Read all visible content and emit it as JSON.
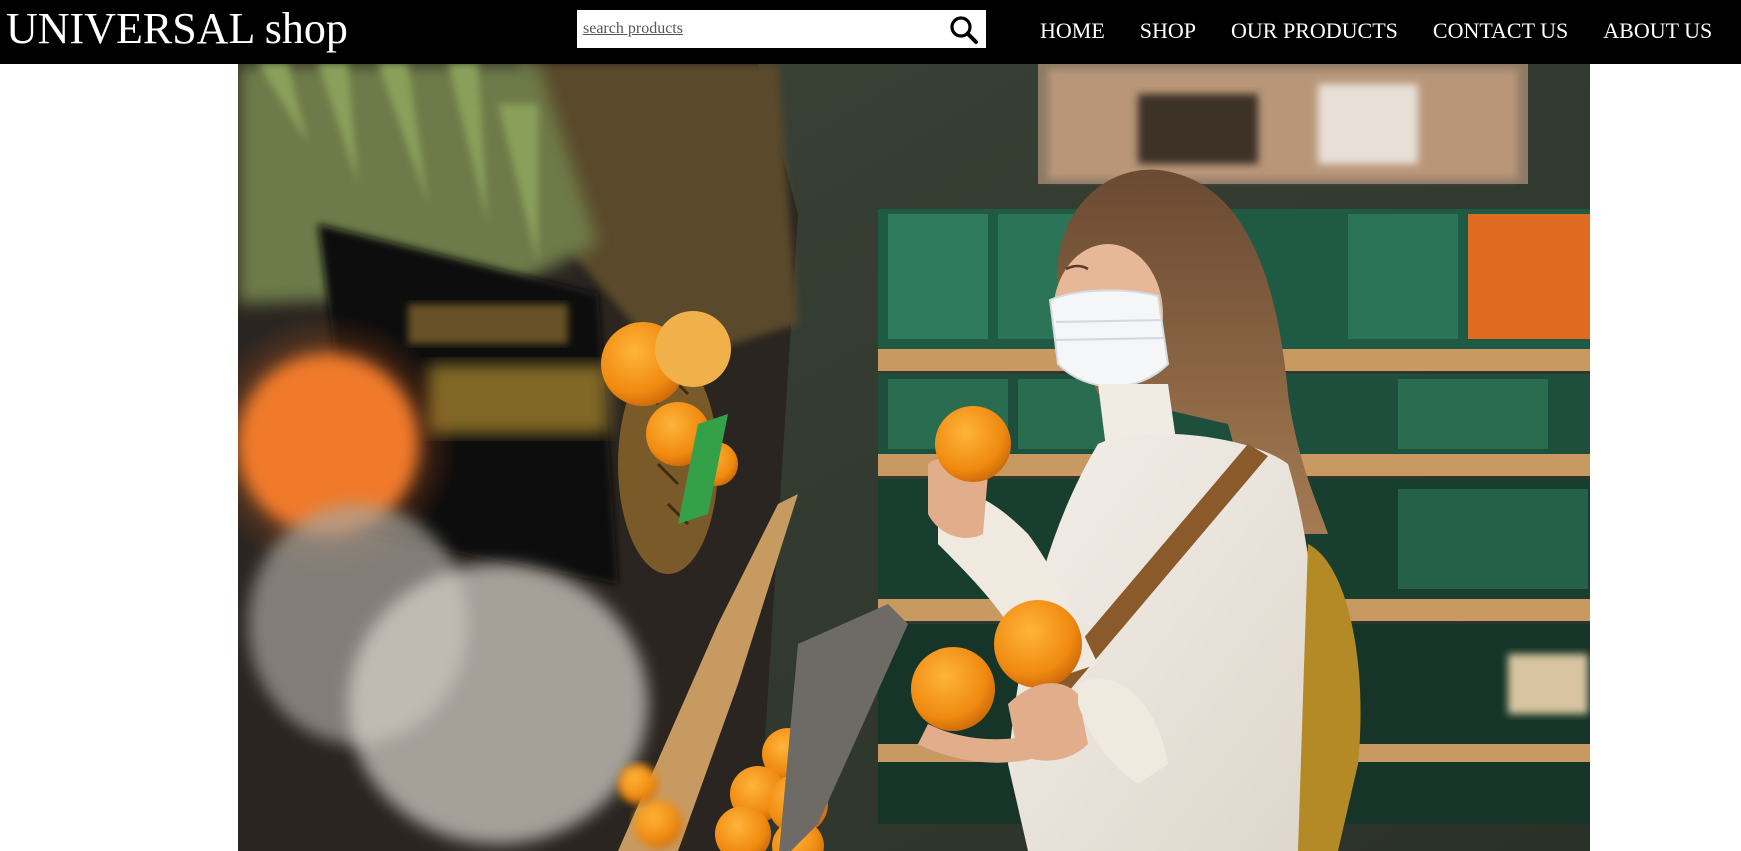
{
  "header": {
    "brand": "UNIVERSAL shop",
    "background": "#000000",
    "text_color": "#ffffff"
  },
  "search": {
    "placeholder": "search products",
    "icon": "search-icon"
  },
  "nav": {
    "items": [
      {
        "label": "HOME"
      },
      {
        "label": "SHOP"
      },
      {
        "label": "OUR PRODUCTS"
      },
      {
        "label": "CONTACT US"
      },
      {
        "label": "ABOUT US"
      }
    ]
  },
  "hero": {
    "image": "woman-with-face-mask-holding-oranges-in-grocery-store"
  }
}
